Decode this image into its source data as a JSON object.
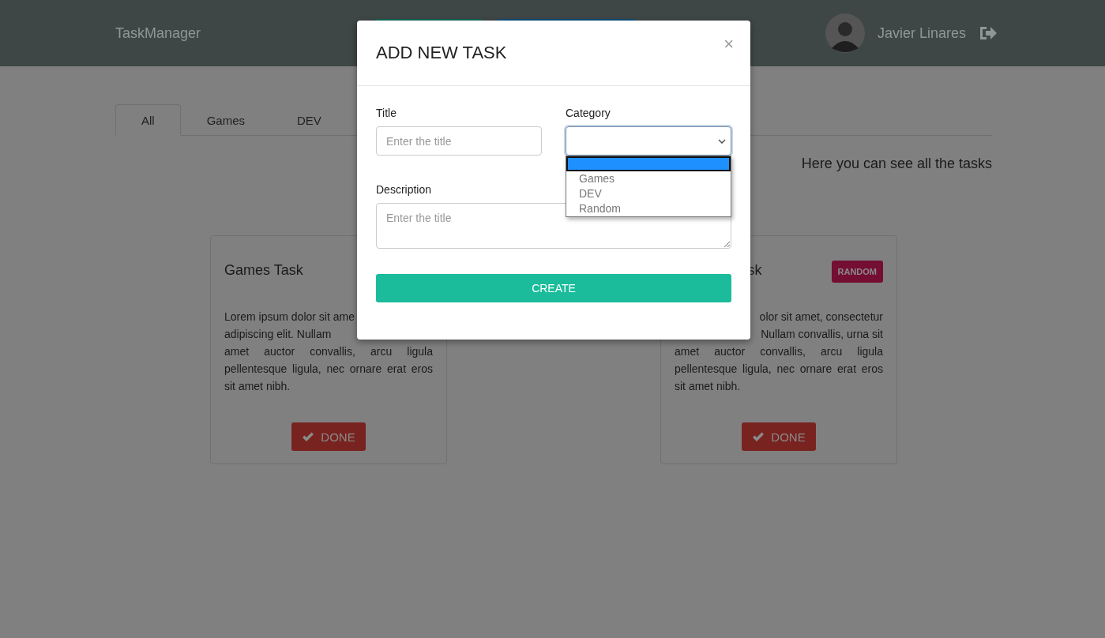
{
  "header": {
    "brand": "TaskManager",
    "nav_buttons": [
      {
        "kind": "success"
      },
      {
        "kind": "primary"
      }
    ],
    "user": {
      "name": "Javier Linares"
    }
  },
  "tabs": [
    {
      "label": "All",
      "selected": true
    },
    {
      "label": "Games",
      "selected": false
    },
    {
      "label": "DEV",
      "selected": false
    }
  ],
  "heading": "Here you can see all the tasks",
  "cards": [
    {
      "title": {
        "text": "Games Task",
        "kind": "full"
      },
      "description_lines": [
        {
          "text": "Lorem ipsum dolor sit ame",
          "kind": "cut_right"
        },
        {
          "text": "adipiscing elit. Nullam",
          "kind": "cut_right"
        },
        {
          "text": "amet auctor convallis, arcu ligula",
          "kind": "full"
        },
        {
          "text": "pellentesque ligula, nec ornare erat eros",
          "kind": "full"
        },
        {
          "text": "sit amet nibh.",
          "kind": "last"
        }
      ],
      "button": "DONE"
    },
    {
      "title": {
        "text": "sk",
        "kind": "cut_left"
      },
      "badge": "RANDOM",
      "description_lines": [
        {
          "text": "olor sit amet, consectetur",
          "kind": "cut_left"
        },
        {
          "text": "Nullam convallis, urna sit",
          "kind": "cut_left"
        },
        {
          "text": "amet auctor convallis, arcu ligula",
          "kind": "full"
        },
        {
          "text": "pellentesque ligula, nec ornare erat eros",
          "kind": "full"
        },
        {
          "text": "sit amet nibh.",
          "kind": "last"
        }
      ],
      "button": "DONE"
    }
  ],
  "modal": {
    "title": "ADD NEW TASK",
    "close": "×",
    "fields": {
      "title": {
        "label": "Title",
        "placeholder": "Enter the title"
      },
      "category": {
        "label": "Category",
        "options": [
          {
            "selected": true
          },
          {
            "label": "Games",
            "selected": false
          },
          {
            "label": "DEV",
            "selected": false
          },
          {
            "label": "Random",
            "selected": false
          }
        ]
      },
      "description": {
        "label": "Description",
        "placeholder": "Enter the title"
      }
    },
    "submit": "CREATE"
  }
}
